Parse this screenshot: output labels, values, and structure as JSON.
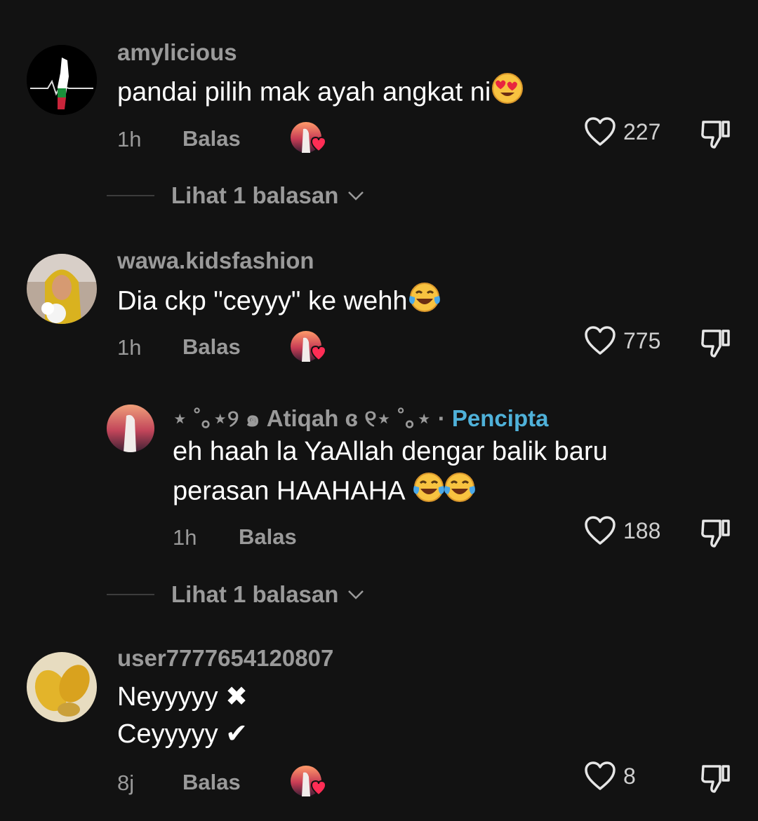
{
  "comments": [
    {
      "username": "amylicious",
      "text": "pandai pilih mak ayah angkat ni",
      "time": "1h",
      "reply_label": "Balas",
      "likes": "227",
      "view_replies": "Lihat 1 balasan"
    },
    {
      "username": "wawa.kidsfashion",
      "text": "Dia ckp \"ceyyy\" ke wehh",
      "time": "1h",
      "reply_label": "Balas",
      "likes": "775",
      "reply": {
        "username": "⋆ ˚｡⋆୨ ๑ Atiqah ɞ ୧⋆ ˚｡⋆ ·",
        "creator_tag": "Pencipta",
        "text_line1": "eh haah la YaAllah dengar balik baru",
        "text_line2": "perasan HAAHAHA",
        "time": "1h",
        "reply_label": "Balas",
        "likes": "188"
      },
      "view_replies": "Lihat 1 balasan"
    },
    {
      "username": "user7777654120807",
      "text_line1": "Neyyyyy ✖",
      "text_line2": "Ceyyyyy ✔",
      "time": "8j",
      "reply_label": "Balas",
      "likes": "8"
    }
  ],
  "colors": {
    "background": "#121212",
    "text_primary": "#ffffff",
    "text_secondary": "#9a9a9a",
    "creator_tag": "#4fb1d9"
  }
}
